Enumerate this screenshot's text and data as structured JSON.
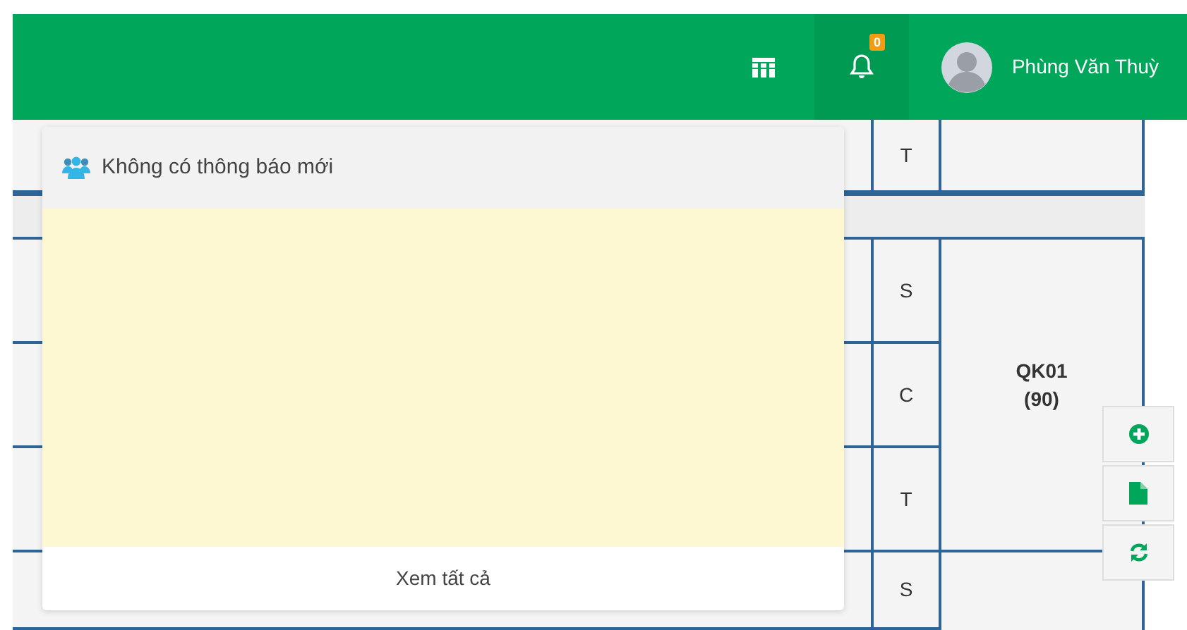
{
  "header": {
    "notification_count": "0",
    "user_name": "Phùng Văn Thuỳ"
  },
  "notification_dropdown": {
    "message": "Không có thông báo mới",
    "footer_link": "Xem tất cả"
  },
  "schedule_table": {
    "rows": [
      {
        "kind": "day",
        "day": "T"
      },
      {
        "kind": "separator"
      },
      {
        "kind": "day",
        "day": "S"
      },
      {
        "kind": "day",
        "day": "C"
      },
      {
        "kind": "day",
        "day": "T"
      },
      {
        "kind": "day",
        "day": "S"
      }
    ],
    "group_cell": {
      "code": "QK01",
      "count": "(90)"
    }
  },
  "side_buttons": [
    {
      "kind": "add"
    },
    {
      "kind": "file"
    },
    {
      "kind": "refresh"
    }
  ]
}
